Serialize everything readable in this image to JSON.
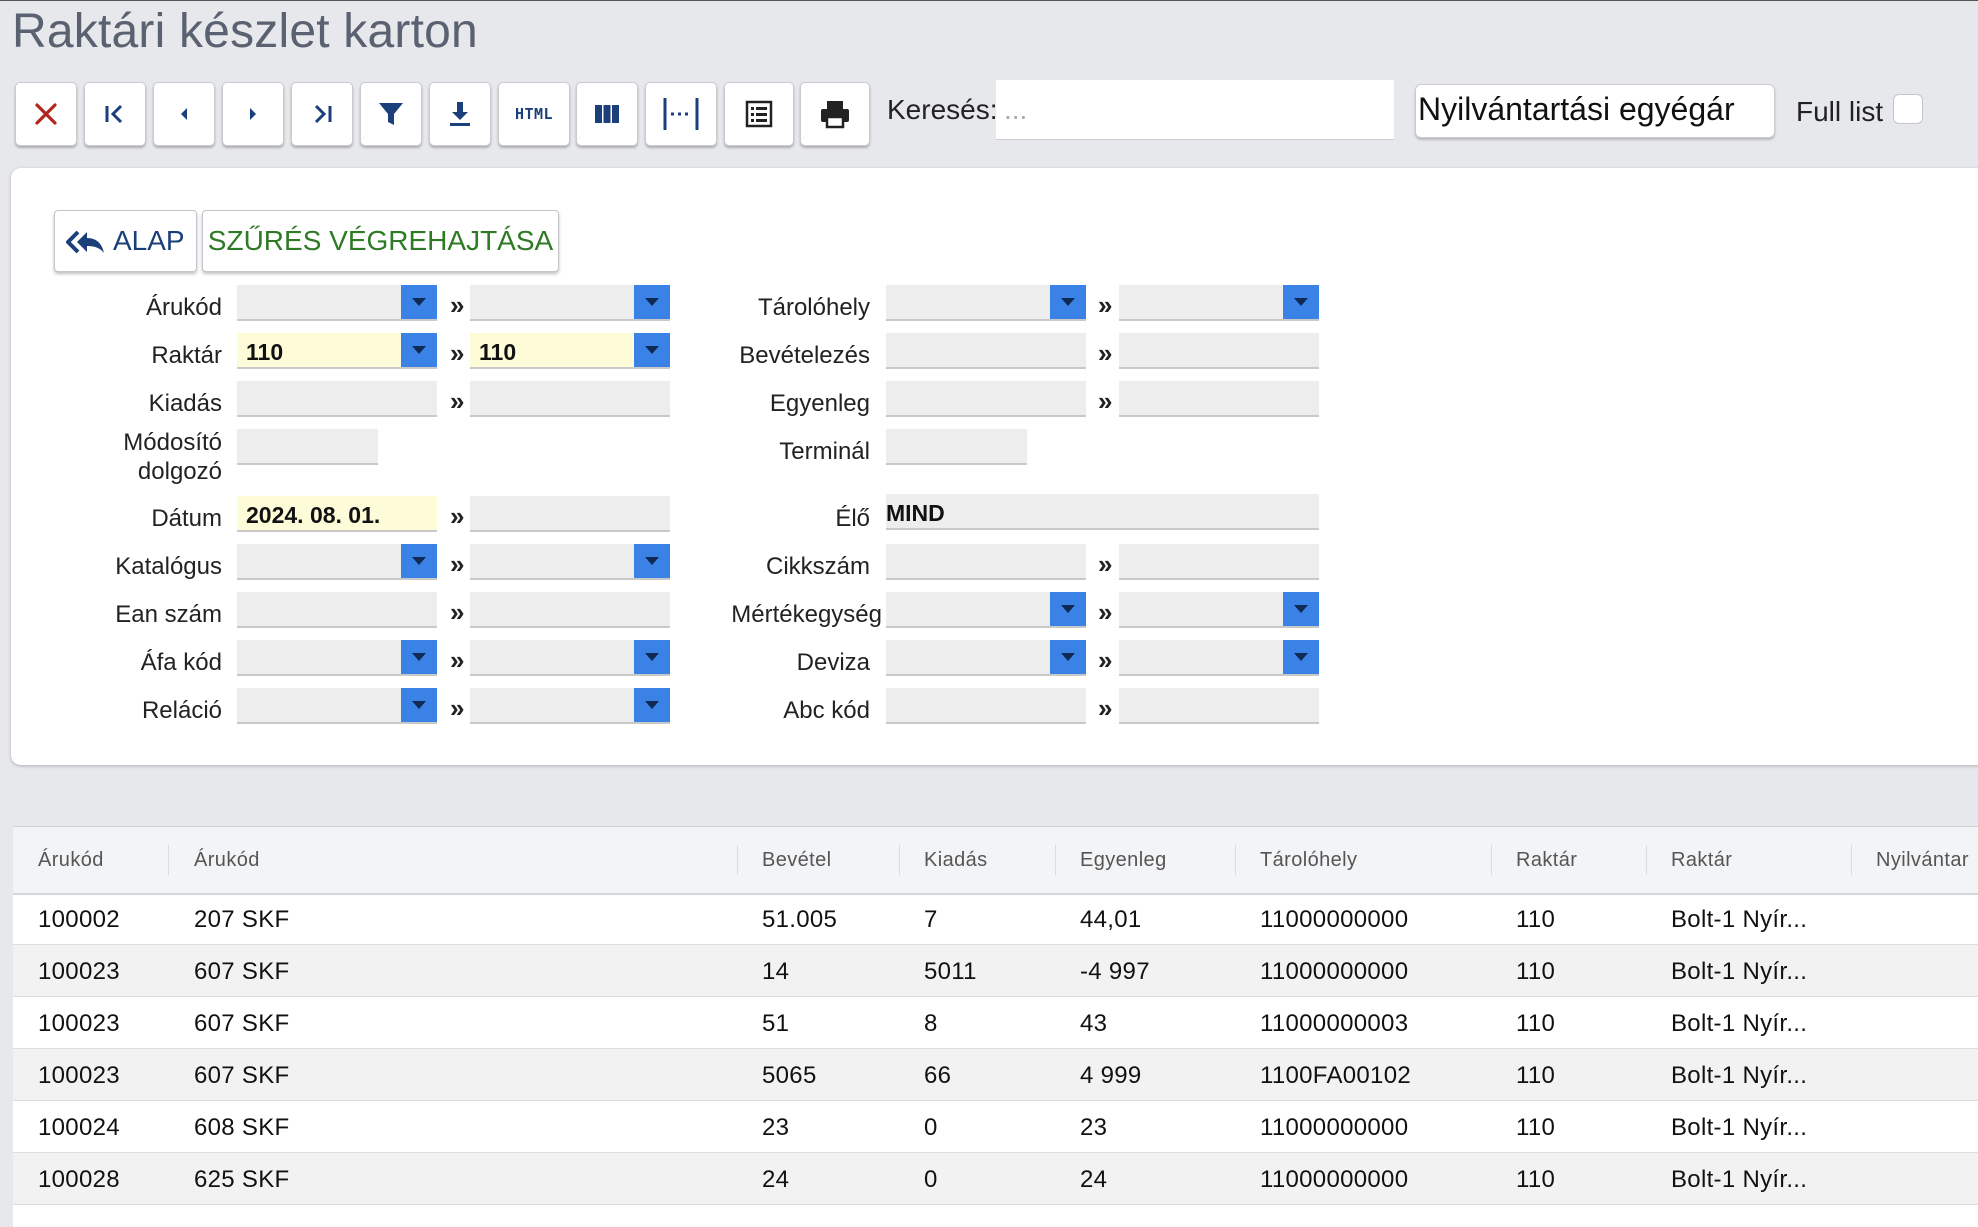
{
  "title": "Raktári készlet karton",
  "toolbar": {
    "html_label": "HTML",
    "search_label": "Keresés:",
    "search_placeholder": "...",
    "price_select": "Nyilvántartási egyégár",
    "full_list_label": "Full list"
  },
  "filter": {
    "alap_label": "ALAP",
    "run_label": "SZŰRÉS VÉGREHAJTÁSA",
    "separator": "»",
    "labels": {
      "arukod": "Árukód",
      "raktar": "Raktár",
      "kiadas": "Kiadás",
      "modosito": "Módosító dolgozó",
      "datum": "Dátum",
      "katalogus": "Katalógus",
      "ean": "Ean szám",
      "afa": "Áfa kód",
      "relacio": "Reláció",
      "tarolohely": "Tárolóhely",
      "bevetelezes": "Bevételezés",
      "egyenleg": "Egyenleg",
      "terminal": "Terminál",
      "elo": "Élő",
      "cikkszam": "Cikkszám",
      "mertekegyseg": "Mértékegység",
      "deviza": "Deviza",
      "abc": "Abc kód"
    },
    "values": {
      "raktar_from": "110",
      "raktar_to": "110",
      "datum_from": "2024. 08. 01.",
      "elo": "MIND"
    }
  },
  "table": {
    "headers": [
      "Árukód",
      "Árukód",
      "Bevétel",
      "Kiadás",
      "Egyenleg",
      "Tárolóhely",
      "Raktár",
      "Raktár",
      "Nyilvántar"
    ],
    "rows": [
      [
        "100002",
        "207 SKF",
        "51.005",
        "7",
        "44,01",
        "11000000000",
        "110",
        "Bolt-1 Nyír..."
      ],
      [
        "100023",
        "607 SKF",
        "14",
        "5011",
        "-4 997",
        "11000000000",
        "110",
        "Bolt-1 Nyír..."
      ],
      [
        "100023",
        "607 SKF",
        "51",
        "8",
        "43",
        "11000000003",
        "110",
        "Bolt-1 Nyír..."
      ],
      [
        "100023",
        "607 SKF",
        "5065",
        "66",
        "4 999",
        "1100FA00102",
        "110",
        "Bolt-1 Nyír..."
      ],
      [
        "100024",
        "608 SKF",
        "23",
        "0",
        "23",
        "11000000000",
        "110",
        "Bolt-1 Nyír..."
      ],
      [
        "100028",
        "625 SKF",
        "24",
        "0",
        "24",
        "11000000000",
        "110",
        "Bolt-1 Nyír..."
      ]
    ]
  }
}
